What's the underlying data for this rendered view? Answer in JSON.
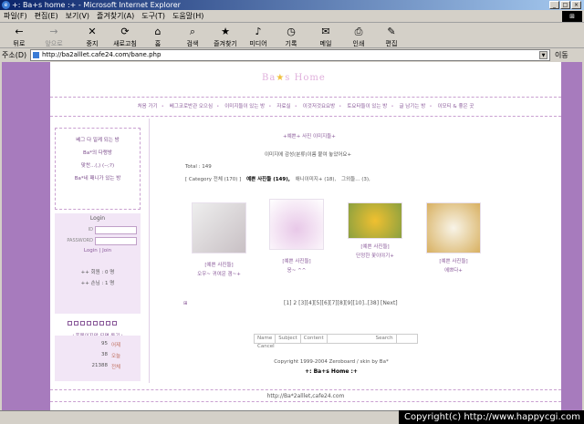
{
  "window": {
    "title": "+: Ba+s home :+ - Microsoft Internet Explorer",
    "min": "_",
    "max": "□",
    "close": "×"
  },
  "menu": [
    "파일(F)",
    "편집(E)",
    "보기(V)",
    "즐겨찾기(A)",
    "도구(T)",
    "도움말(H)"
  ],
  "toolbar": [
    {
      "label": "뒤로",
      "icon": "←"
    },
    {
      "label": "앞으로",
      "icon": "→"
    },
    {
      "label": "중지",
      "icon": "✕"
    },
    {
      "label": "새로고침",
      "icon": "⟳"
    },
    {
      "label": "홈",
      "icon": "⌂"
    },
    {
      "label": "검색",
      "icon": "⌕"
    },
    {
      "label": "즐겨찾기",
      "icon": "★"
    },
    {
      "label": "미디어",
      "icon": "♪"
    },
    {
      "label": "기록",
      "icon": "◷"
    },
    {
      "label": "메일",
      "icon": "✉"
    },
    {
      "label": "인쇄",
      "icon": "⎙"
    },
    {
      "label": "편집",
      "icon": "✎"
    }
  ],
  "address": {
    "label": "주소(D)",
    "url": "http://ba2alllet.cafe24.com/bane.php",
    "go": "이동"
  },
  "site": {
    "logo_a": "Ba",
    "logo_star": "★",
    "logo_b": "s Home",
    "nav": [
      "처음 가기",
      "베그코로반관 오으심",
      "이미지들이 있는 방",
      "자료실",
      "이것저것요요방",
      "토요타들이 있는 방",
      "글 남기는 방",
      "이모티 & 좋은 곳"
    ],
    "left_links": [
      "베그 다 일케 되는 방",
      "Ba*의 다랭방",
      "맞찬...(,) (--;?)",
      "Ba*네 패니가 있는 방"
    ],
    "login": {
      "title": "Login",
      "id_label": "ID",
      "pw_label": "PASSWORD",
      "links": "Login  |  Join",
      "today": "++ 회원 :   0 명",
      "online": "++ 손님 :   1 명"
    },
    "homepage_link": "+홈페이지만 되면 동기+",
    "counter": [
      {
        "n": "95",
        "l": "어제"
      },
      {
        "n": "38",
        "l": "오늘"
      },
      {
        "n": "21388",
        "l": "전체"
      }
    ],
    "board_title": "+예쁜+ 사진 이미지들+",
    "board_sub": "이미지에 감성(분류)이름 붙여 놓았어요+",
    "total": "Total : 149",
    "categories": [
      {
        "label": "[ Category 전체 (170) ]",
        "on": false
      },
      {
        "label": "예쁜 사진들 (149),",
        "on": true
      },
      {
        "label": "애니이미지+ (18),",
        "on": false
      },
      {
        "label": "그외들... (3),",
        "on": false
      }
    ],
    "thumbs": [
      {
        "tag": "[예쁜 사진들]",
        "title": "오우~ 귀여운 갬~+",
        "color": "#dcd4d8"
      },
      {
        "tag": "[예쁜 사진들]",
        "title": "응~ ^^",
        "color": "#e8c8e8"
      },
      {
        "tag": "[예쁜 사진들]",
        "title": "단정한 꽃이야기+",
        "color": "#d8a820"
      },
      {
        "tag": "[예쁜 사진들]",
        "title": "에쁘다+",
        "color": "#e8d8a0"
      }
    ],
    "pager": "[1] 2 [3][4][5][6][7][8][9][10]..[38] [Next]",
    "search": [
      "Name",
      "Subject",
      "Content",
      "",
      "Search",
      "Cancel"
    ],
    "copyright": "Copyright 1999-2004 Zeroboard / skin by Ba*",
    "brand": "+: Ba+s Home :+",
    "footer": "http://Ba*2alllet,cafe24.com"
  },
  "watermark": "Copyright(c) http://www.happycgi.com"
}
